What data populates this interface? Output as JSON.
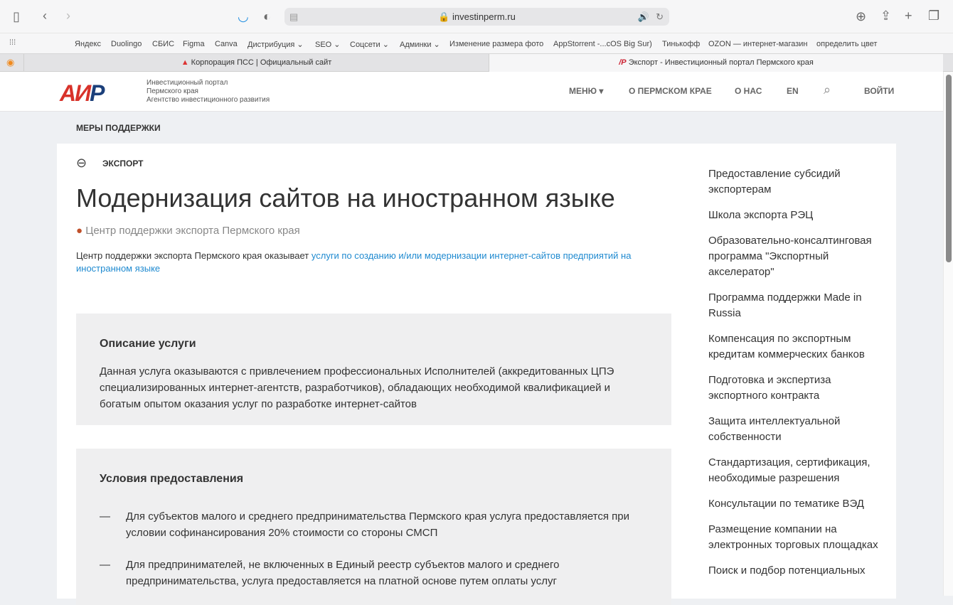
{
  "browser": {
    "url": "investinperm.ru",
    "bookmarks": [
      "Яндекс",
      "Duolingo",
      "СБИС",
      "Figma",
      "Canva",
      "Дистрибуция ⌄",
      "SEO ⌄",
      "Соцсети ⌄",
      "Админки ⌄",
      "Изменение размера фото",
      "AppStorrent -...cOS Big Sur)",
      "Тинькофф",
      "OZON — интернет-магазин",
      "определить цвет"
    ],
    "tabs": [
      "Корпорация ПСС | Официальный сайт",
      "Экспорт - Инвестиционный портал Пермского края"
    ]
  },
  "site": {
    "logo": "АИР",
    "tagline": [
      "Инвестиционный портал",
      "Пермского края",
      "Агентство инвестиционного развития"
    ],
    "nav": [
      "МЕНЮ ▾",
      "О ПЕРМСКОМ КРАЕ",
      "О НАС",
      "EN",
      "ВОЙТИ"
    ]
  },
  "breadcrumb": "МЕРЫ ПОДДЕРЖКИ",
  "section": "ЭКСПОРТ",
  "title": "Модернизация сайтов на иностранном языке",
  "source": "Центр поддержки экспорта Пермского края",
  "lead": {
    "text": "Центр поддержки экспорта Пермского края оказывает ",
    "link": "услуги по созданию и/или модернизации интернет-сайтов предприятий на иностранном языке"
  },
  "description": {
    "heading": "Описание услуги",
    "text": "Данная услуга оказываются с привлечением профессиональных Исполнителей (аккредитованных ЦПЭ специализированных интернет-агентств, разработчиков), обладающих необходимой квалификацией и богатым опытом оказания услуг по разработке интернет-сайтов"
  },
  "conditions": {
    "heading": "Условия предоставления",
    "items": [
      "Для субъектов малого и среднего предпринимательства Пермского края услуга предоставляется при условии софинансирования 20% стоимости со стороны СМСП",
      "Для предпринимателей, не включенных в Единый реестр субъектов малого и среднего предпринимательства, услуга предоставляется на платной основе путем оплаты услуг"
    ]
  },
  "sidebar": [
    "Предоставление субсидий экспортерам",
    "Школа экспорта РЭЦ",
    "Образовательно-консалтинговая программа \"Экспортный акселератор\"",
    "Программа поддержки Made in Russia",
    "Компенсация по экспортным кредитам коммерческих банков",
    "Подготовка и экспертиза экспортного контракта",
    "Защита интеллектуальной собственности",
    "Стандартизация, сертификация, необходимые разрешения",
    "Консультации по тематике ВЭД",
    "Размещение компании на электронных торговых площадках",
    "Поиск и подбор потенциальных"
  ]
}
